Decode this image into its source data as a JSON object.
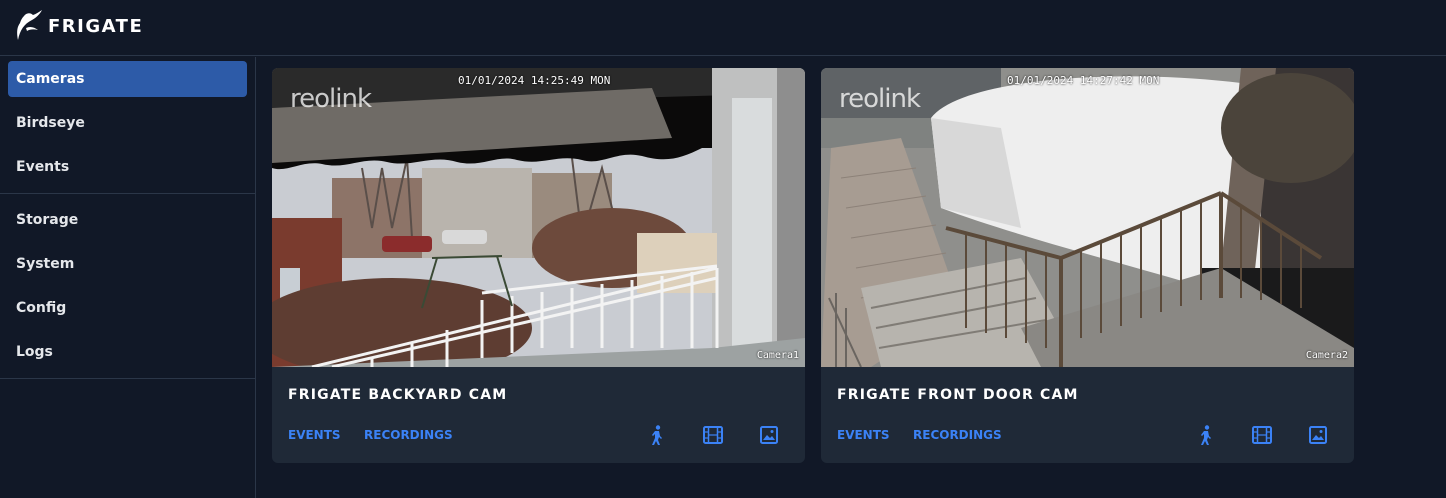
{
  "app": {
    "title": "FRIGATE"
  },
  "sidebar": {
    "items": [
      {
        "label": "Cameras",
        "active": true
      },
      {
        "label": "Birdseye"
      },
      {
        "label": "Events"
      },
      {
        "label": "Storage"
      },
      {
        "label": "System"
      },
      {
        "label": "Config"
      },
      {
        "label": "Logs"
      }
    ]
  },
  "cameras": [
    {
      "name": "FRIGATE BACKYARD CAM",
      "timestamp": "01/01/2024 14:25:49 MON",
      "watermark": "reolink",
      "overlay_label": "Camera1",
      "events_label": "EVENTS",
      "recordings_label": "RECORDINGS",
      "icons": [
        "person-icon",
        "film-icon",
        "image-icon"
      ]
    },
    {
      "name": "FRIGATE FRONT DOOR CAM",
      "timestamp": "01/01/2024 14:27:42 MON",
      "watermark": "reolink",
      "overlay_label": "Camera2",
      "events_label": "EVENTS",
      "recordings_label": "RECORDINGS",
      "icons": [
        "person-icon",
        "film-icon",
        "image-icon"
      ]
    }
  ],
  "colors": {
    "accent": "#3b82f6",
    "active_nav": "#2d5ba8",
    "background": "#111827",
    "card": "#1f2937"
  }
}
